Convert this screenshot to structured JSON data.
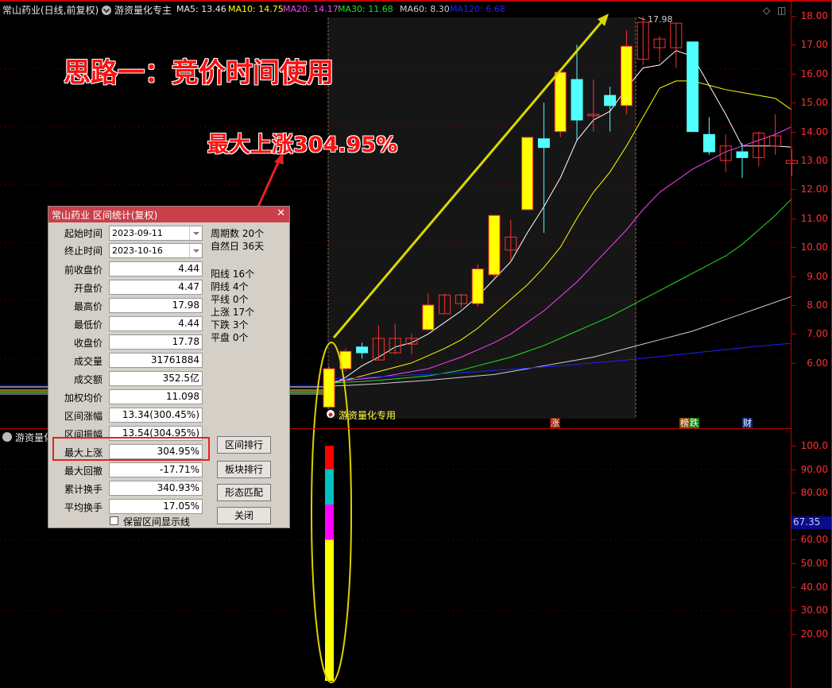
{
  "header": {
    "title": "常山药业(日线,前复权)",
    "indicator_name": "游资量化专主",
    "ma": [
      {
        "label": "MA5: 13.46",
        "color": "#e8e8e8"
      },
      {
        "label": "MA10: 14.75",
        "color": "#ffff00"
      },
      {
        "label": "MA20: 14.17",
        "color": "#ff40ff"
      },
      {
        "label": "MA30: 11.68",
        "color": "#20e020"
      },
      {
        "label": "MA60: 8.30",
        "color": "#d0d0d0"
      },
      {
        "label": "MA120: 6.68",
        "color": "#2020ff"
      }
    ]
  },
  "annotations": {
    "headline": "思路一：竞价时间使用",
    "max_rise": "最大上涨304.95%",
    "high_price": "17.98",
    "indicator_label": "游资量化专用",
    "badges": [
      {
        "text": "涨",
        "color": "#8b1a00"
      },
      {
        "text": "榜",
        "color": "#8b5000"
      },
      {
        "text": "跌",
        "color": "#108010"
      },
      {
        "text": "财",
        "color": "#102a80"
      }
    ]
  },
  "sub_panel": {
    "title": "游资量化",
    "highlight_value": "67.35",
    "stack_segments": [
      {
        "color": "#ff0000",
        "from": 90,
        "to": 100
      },
      {
        "color": "#00c0c0",
        "from": 75,
        "to": 90
      },
      {
        "color": "#ff00ff",
        "from": 60,
        "to": 75
      },
      {
        "color": "#ffff00",
        "from": 0,
        "to": 60
      }
    ]
  },
  "price_axis": [
    "18.00",
    "17.00",
    "16.00",
    "15.00",
    "14.00",
    "13.00",
    "12.00",
    "11.00",
    "10.00",
    "9.00",
    "8.00",
    "7.00",
    "6.00"
  ],
  "sub_axis": [
    "100.0",
    "90.00",
    "80.00",
    "60.00",
    "50.00",
    "40.00",
    "30.00",
    "20.00"
  ],
  "dialog": {
    "title": "常山药业 区间统计(复权)",
    "start_label": "起始时间",
    "start_value": "2023-09-11",
    "end_label": "终止时间",
    "end_value": "2023-10-16",
    "rows": [
      {
        "label": "前收盘价",
        "value": "4.44"
      },
      {
        "label": "开盘价",
        "value": "4.47"
      },
      {
        "label": "最高价",
        "value": "17.98"
      },
      {
        "label": "最低价",
        "value": "4.44"
      },
      {
        "label": "收盘价",
        "value": "17.78"
      },
      {
        "label": "成交量",
        "value": "31761884"
      },
      {
        "label": "成交额",
        "value": "352.5亿"
      },
      {
        "label": "加权均价",
        "value": "11.098"
      },
      {
        "label": "区间涨幅",
        "value": "13.34(300.45%)"
      },
      {
        "label": "区间振幅",
        "value": "13.54(304.95%)"
      },
      {
        "label": "最大上涨",
        "value": "304.95%"
      },
      {
        "label": "最大回撤",
        "value": "-17.71%"
      },
      {
        "label": "累计换手",
        "value": "340.93%"
      },
      {
        "label": "平均换手",
        "value": "17.05%"
      }
    ],
    "stats": [
      "周期数 20个",
      "自然日 36天",
      "阳线 16个",
      "阴线 4个",
      "平线 0个",
      "上涨 17个",
      "下跌 3个",
      "平盘 0个"
    ],
    "buttons": [
      "区间排行",
      "板块排行",
      "形态匹配",
      "关闭"
    ],
    "checkbox_label": "保留区间显示线",
    "checkbox_checked": false
  },
  "chart_data": {
    "type": "candlestick",
    "title": "常山药业(日线,前复权)",
    "ylim": [
      5.2,
      18.3
    ],
    "candles": [
      {
        "o": 4.47,
        "c": 5.8,
        "h": 5.9,
        "l": 4.44,
        "up": true,
        "fill": "yellow"
      },
      {
        "o": 5.8,
        "c": 6.4,
        "h": 6.5,
        "l": 5.7,
        "up": true,
        "fill": "yellow"
      },
      {
        "o": 6.55,
        "c": 6.35,
        "h": 6.7,
        "l": 6.15,
        "up": false
      },
      {
        "o": 6.1,
        "c": 6.85,
        "h": 7.3,
        "l": 6.1,
        "up": true,
        "fill": "hollow"
      },
      {
        "o": 6.35,
        "c": 6.85,
        "h": 7.35,
        "l": 6.3,
        "up": true,
        "fill": "hollow"
      },
      {
        "o": 6.65,
        "c": 6.85,
        "h": 7.0,
        "l": 6.3,
        "up": true,
        "fill": "hollow"
      },
      {
        "o": 7.15,
        "c": 8.0,
        "h": 8.4,
        "l": 7.15,
        "up": true,
        "fill": "yellow"
      },
      {
        "o": 7.7,
        "c": 8.35,
        "h": 8.4,
        "l": 7.7,
        "up": true,
        "fill": "hollow"
      },
      {
        "o": 8.05,
        "c": 8.35,
        "h": 8.4,
        "l": 7.9,
        "up": true,
        "fill": "hollow"
      },
      {
        "o": 8.05,
        "c": 9.25,
        "h": 9.4,
        "l": 7.95,
        "up": true,
        "fill": "yellow"
      },
      {
        "o": 9.05,
        "c": 11.1,
        "h": 11.1,
        "l": 8.95,
        "up": true,
        "fill": "yellow"
      },
      {
        "o": 9.9,
        "c": 10.35,
        "h": 10.95,
        "l": 9.5,
        "up": true,
        "fill": "hollow"
      },
      {
        "o": 11.3,
        "c": 13.8,
        "h": 13.8,
        "l": 11.3,
        "up": true,
        "fill": "yellow"
      },
      {
        "o": 13.75,
        "c": 13.45,
        "h": 15.0,
        "l": 10.5,
        "up": false
      },
      {
        "o": 14.0,
        "c": 16.05,
        "h": 16.05,
        "l": 13.8,
        "up": true,
        "fill": "yellow"
      },
      {
        "o": 15.8,
        "c": 14.4,
        "h": 17.0,
        "l": 13.7,
        "up": false
      },
      {
        "o": 14.55,
        "c": 14.6,
        "h": 15.8,
        "l": 14.0,
        "up": true,
        "fill": "hollow"
      },
      {
        "o": 14.9,
        "c": 15.25,
        "h": 15.55,
        "l": 14.0,
        "up": false
      },
      {
        "o": 14.9,
        "c": 16.95,
        "h": 17.5,
        "l": 14.6,
        "up": true,
        "fill": "yellow"
      },
      {
        "o": 16.5,
        "c": 17.78,
        "h": 17.98,
        "l": 16.3,
        "up": true,
        "fill": "hollow"
      },
      {
        "o": 16.9,
        "c": 17.2,
        "h": 17.3,
        "l": 16.4,
        "up": true,
        "fill": "hollow"
      },
      {
        "o": 16.9,
        "c": 17.75,
        "h": 17.75,
        "l": 16.2,
        "up": true,
        "fill": "hollow"
      },
      {
        "o": 17.1,
        "c": 14.0,
        "h": 17.1,
        "l": 14.0,
        "up": false
      },
      {
        "o": 13.9,
        "c": 13.3,
        "h": 14.5,
        "l": 13.2,
        "up": false
      },
      {
        "o": 13.0,
        "c": 13.5,
        "h": 13.9,
        "l": 12.6,
        "up": true,
        "fill": "hollow"
      },
      {
        "o": 13.3,
        "c": 13.1,
        "h": 13.6,
        "l": 12.4,
        "up": false
      },
      {
        "o": 13.1,
        "c": 13.95,
        "h": 14.0,
        "l": 12.8,
        "up": true,
        "fill": "hollow"
      },
      {
        "o": 13.5,
        "c": 13.85,
        "h": 14.6,
        "l": 13.2,
        "up": true,
        "fill": "hollow"
      },
      {
        "o": 12.9,
        "c": 13.0,
        "h": 13.4,
        "l": 12.45,
        "up": true,
        "fill": "hollow"
      }
    ],
    "ma_series": [
      {
        "name": "MA5",
        "color": "#ffffff",
        "values": [
          5.2,
          5.5,
          5.9,
          6.2,
          6.55,
          6.7,
          7.0,
          7.4,
          7.8,
          8.3,
          8.9,
          9.5,
          10.5,
          11.4,
          12.4,
          13.7,
          14.4,
          14.7,
          15.5,
          16.2,
          16.3,
          16.8,
          16.6,
          15.6,
          14.6,
          13.5,
          13.5,
          13.5,
          13.46
        ]
      },
      {
        "name": "MA10",
        "color": "#ffff00",
        "values": [
          5.3,
          5.4,
          5.55,
          5.7,
          5.85,
          6.0,
          6.25,
          6.5,
          6.8,
          7.2,
          7.7,
          8.2,
          8.7,
          9.3,
          10.0,
          11.0,
          11.9,
          12.6,
          13.5,
          14.5,
          15.5,
          15.75,
          15.75,
          15.6,
          15.45,
          15.35,
          15.25,
          15.15,
          14.75
        ]
      },
      {
        "name": "MA20",
        "color": "#ff40ff",
        "values": [
          5.35,
          5.4,
          5.45,
          5.5,
          5.6,
          5.7,
          5.8,
          6.0,
          6.2,
          6.45,
          6.7,
          7.0,
          7.4,
          7.8,
          8.3,
          8.8,
          9.4,
          10.0,
          10.6,
          11.3,
          11.9,
          12.3,
          12.7,
          13.0,
          13.3,
          13.5,
          13.7,
          13.9,
          14.17
        ]
      },
      {
        "name": "MA30",
        "color": "#20e020",
        "values": [
          5.3,
          5.33,
          5.36,
          5.4,
          5.45,
          5.5,
          5.55,
          5.65,
          5.75,
          5.9,
          6.05,
          6.2,
          6.4,
          6.6,
          6.85,
          7.1,
          7.35,
          7.6,
          7.9,
          8.2,
          8.5,
          8.8,
          9.1,
          9.4,
          9.7,
          10.1,
          10.6,
          11.1,
          11.68
        ]
      },
      {
        "name": "MA60",
        "color": "#d0d0d0",
        "values": [
          5.2,
          5.22,
          5.25,
          5.28,
          5.32,
          5.36,
          5.4,
          5.45,
          5.5,
          5.55,
          5.6,
          5.7,
          5.8,
          5.9,
          6.0,
          6.1,
          6.2,
          6.35,
          6.5,
          6.65,
          6.8,
          6.95,
          7.1,
          7.3,
          7.5,
          7.7,
          7.9,
          8.1,
          8.3
        ]
      },
      {
        "name": "MA120",
        "color": "#2020ff",
        "values": [
          5.45,
          5.47,
          5.5,
          5.52,
          5.55,
          5.58,
          5.6,
          5.63,
          5.66,
          5.7,
          5.74,
          5.78,
          5.82,
          5.86,
          5.9,
          5.95,
          6.0,
          6.05,
          6.1,
          6.16,
          6.22,
          6.28,
          6.34,
          6.4,
          6.46,
          6.52,
          6.58,
          6.63,
          6.68
        ]
      }
    ]
  }
}
